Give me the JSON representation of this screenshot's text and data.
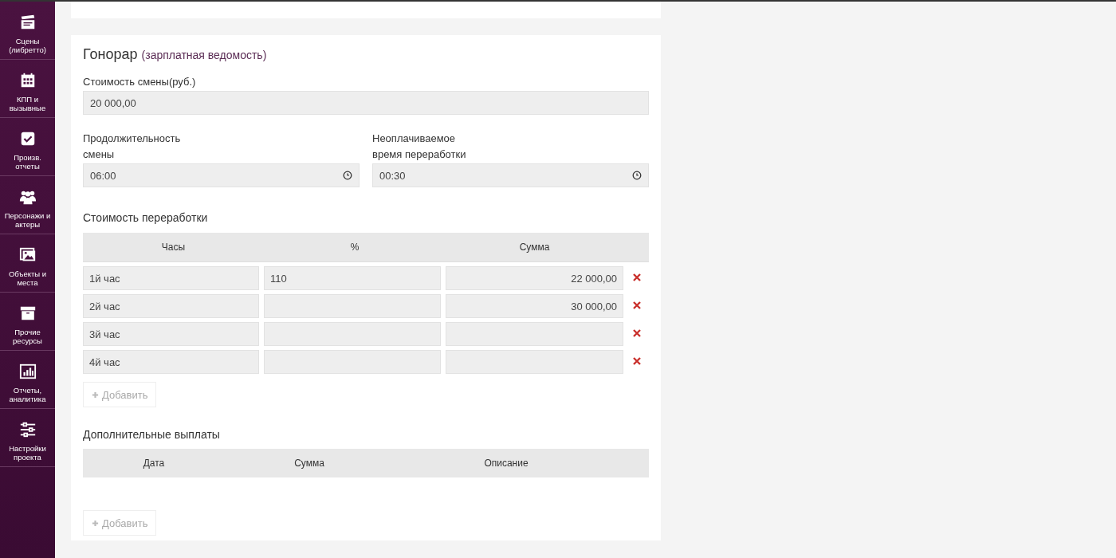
{
  "sidebar": {
    "items": [
      {
        "kind": "clapper",
        "label": "Сцены (либретто)"
      },
      {
        "kind": "calendar",
        "label": "КПП и вызывные"
      },
      {
        "kind": "check",
        "label": "Произв. отчеты"
      },
      {
        "kind": "people",
        "label": "Персонажи и актеры"
      },
      {
        "kind": "image",
        "label": "Объекты и места"
      },
      {
        "kind": "box",
        "label": "Прочие ресурсы"
      },
      {
        "kind": "chart",
        "label": "Отчеты, аналитика"
      },
      {
        "kind": "sliders",
        "label": "Настройки проекта"
      }
    ]
  },
  "fee": {
    "title": "Гонорар",
    "subtitle": "(зарплатная ведомость)",
    "shift_cost": {
      "label": "Стоимость смены(руб.)",
      "value": "20 000,00"
    },
    "shift_duration": {
      "label": "Продолжительность смены",
      "value": "06:00"
    },
    "unpaid_overtime": {
      "label": "Неоплачиваемое время переработки",
      "value": "00:30"
    },
    "overtime": {
      "title": "Стоимость переработки",
      "columns": [
        "Часы",
        "%",
        "Сумма"
      ],
      "rows": [
        {
          "hours": "1й час",
          "percent": "110",
          "sum": "22 000,00"
        },
        {
          "hours": "2й час",
          "percent": "",
          "sum": "30 000,00"
        },
        {
          "hours": "3й час",
          "percent": "",
          "sum": ""
        },
        {
          "hours": "4й час",
          "percent": "",
          "sum": ""
        }
      ],
      "add_button": "Добавить"
    },
    "extra_payments": {
      "title": "Дополнительные выплаты",
      "columns": [
        "Дата",
        "Сумма",
        "Описание"
      ],
      "add_button": "Добавить"
    }
  }
}
